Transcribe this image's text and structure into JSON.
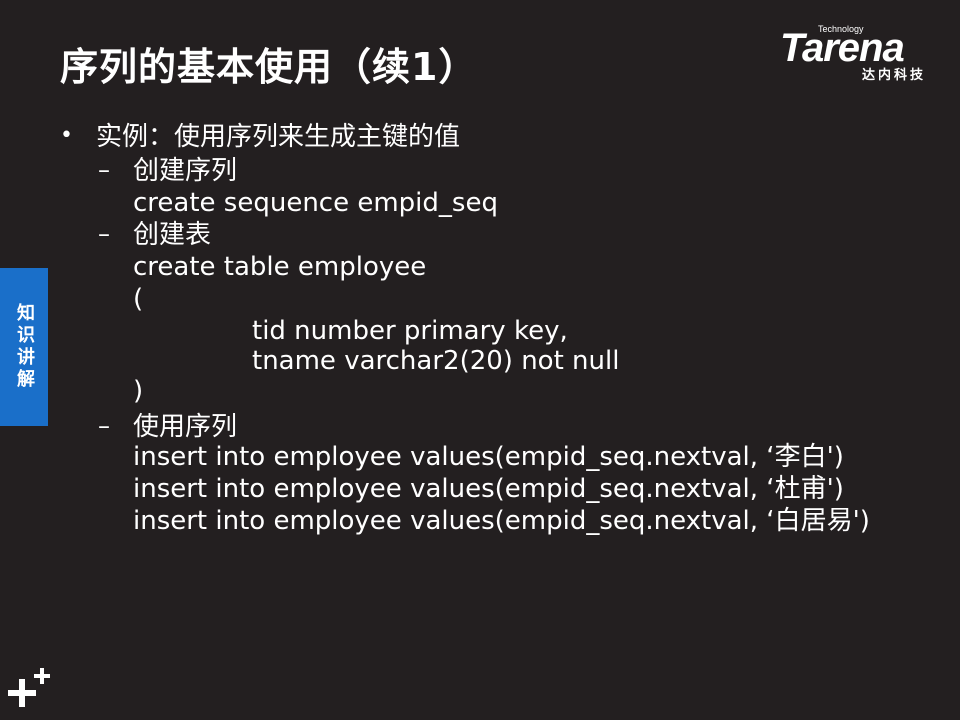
{
  "slide": {
    "title": "序列的基本使用（续1）",
    "side_tab": "知识讲解"
  },
  "logo": {
    "technology": "Technology",
    "word": "Tarena",
    "chinese": "达内科技"
  },
  "content": {
    "bullet_marker": "•",
    "dash_marker": "–",
    "bullet": "实例：使用序列来生成主键的值",
    "items": [
      {
        "heading": "创建序列",
        "lines": [
          "create sequence empid_seq"
        ]
      },
      {
        "heading": "创建表",
        "lines": [
          "create table employee",
          "(",
          "tid number primary key,",
          "tname varchar2(20) not null",
          ")"
        ]
      },
      {
        "heading": "使用序列",
        "lines": [
          "insert into employee values(empid_seq.nextval,  ‘李白')",
          "insert into employee values(empid_seq.nextval,  ‘杜甫')",
          "insert into employee values(empid_seq.nextval,  ‘白居易')"
        ]
      }
    ]
  }
}
